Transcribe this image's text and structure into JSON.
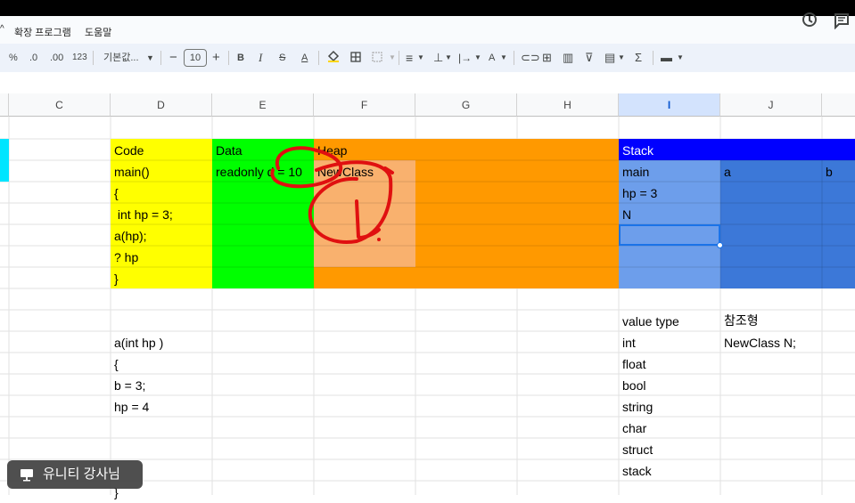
{
  "menu": {
    "extensions": "확장 프로그램",
    "help": "도움말"
  },
  "toolbar": {
    "percent": "%",
    "decrease_decimal": ".0",
    "increase_decimal": ".00",
    "number_format": "123",
    "font_name": "기본값...",
    "font_size": "10",
    "bold": "B",
    "italic": "I",
    "strikethrough": "S",
    "text_color": "A"
  },
  "columns": [
    "C",
    "D",
    "E",
    "F",
    "G",
    "H",
    "I",
    "J"
  ],
  "selected_column": "I",
  "colors": {
    "yellow": "#ffff00",
    "green": "#00ff00",
    "orange": "#ff9900",
    "light_orange": "#f9b16e",
    "blue": "#0000ff",
    "stack_light": "#6d9eeb",
    "stack_dark": "#3c78d8",
    "cyan": "#00e5ff",
    "selection": "#1a73e8",
    "ink": "#e01010"
  },
  "code_block": [
    "Code",
    "main()",
    "{",
    " int hp = 3;",
    "a(hp);",
    "? hp",
    "}"
  ],
  "data_block": {
    "header": "Data",
    "value": "readonly d = 10"
  },
  "heap_block": {
    "header": "Heap",
    "value": "NewClass"
  },
  "stack_block": {
    "header": "Stack",
    "rows": [
      [
        "main",
        "a",
        "b"
      ],
      [
        "hp = 3",
        "",
        ""
      ],
      [
        "N",
        "",
        ""
      ]
    ]
  },
  "function_block": [
    "a(int hp )",
    "{",
    "b = 3;",
    "hp = 4",
    "",
    "",
    "",
    "}"
  ],
  "value_types": {
    "header": "value type",
    "items": [
      "int",
      "float",
      "bool",
      "string",
      "char",
      "struct",
      "stack"
    ]
  },
  "reference_types": {
    "header": "참조형",
    "items": [
      "NewClass N;"
    ]
  },
  "badge": {
    "text": "유니티 강사님"
  }
}
